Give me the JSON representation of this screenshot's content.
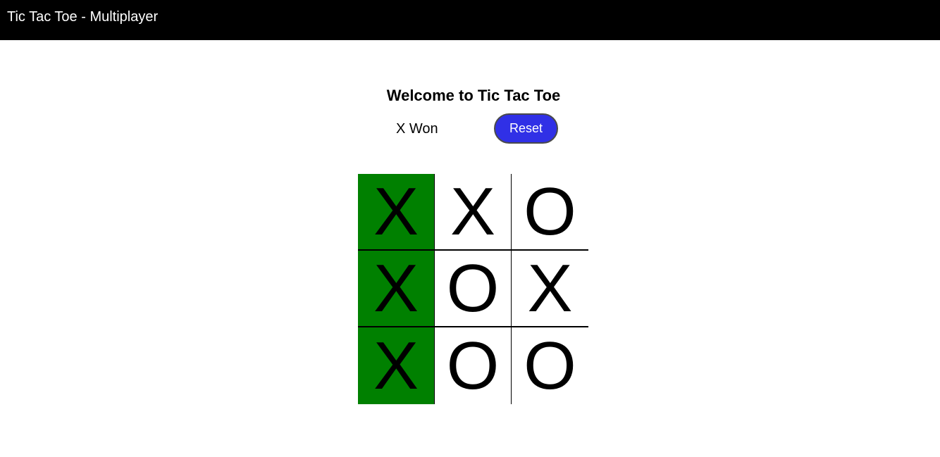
{
  "app": {
    "title": "Tic Tac Toe - Multiplayer"
  },
  "game": {
    "heading": "Welcome to Tic Tac Toe",
    "status": "X Won",
    "reset_label": "Reset",
    "winner": "X",
    "winning_cells": [
      0,
      3,
      6
    ],
    "board": [
      "X",
      "X",
      "O",
      "X",
      "O",
      "X",
      "X",
      "O",
      "O"
    ]
  },
  "colors": {
    "topbar_bg": "#000000",
    "reset_button_bg": "#3030e6",
    "winning_cell_bg": "#008000",
    "cell_bg": "#ffffff",
    "grid_line": "#000000"
  }
}
